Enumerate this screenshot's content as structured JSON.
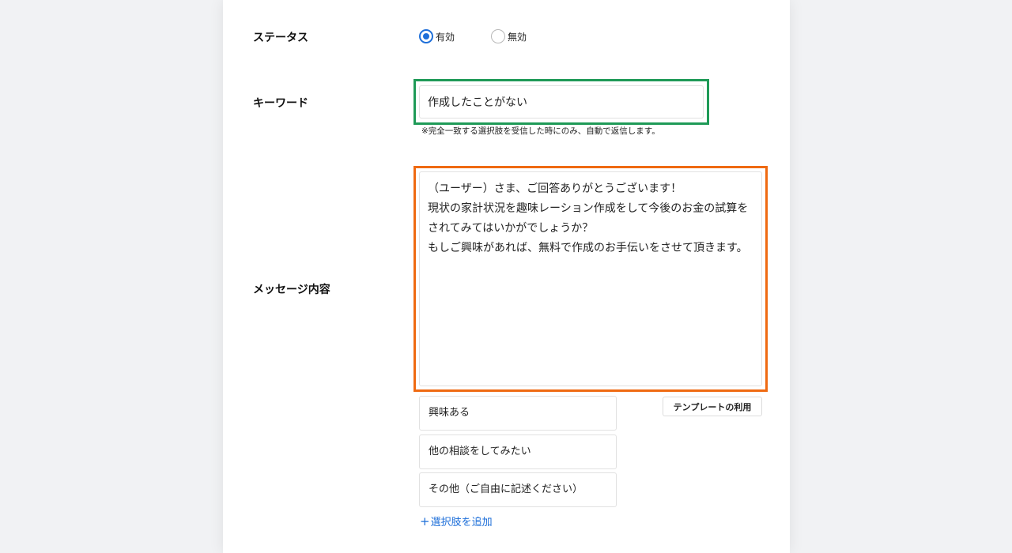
{
  "status": {
    "label": "ステータス",
    "options": [
      {
        "label": "有効",
        "selected": true
      },
      {
        "label": "無効",
        "selected": false
      }
    ]
  },
  "keyword": {
    "label": "キーワード",
    "value": "作成したことがない",
    "hint": "※完全一致する選択肢を受信した時にのみ、自動で返信します。",
    "highlight_color": "#1f9a57"
  },
  "message": {
    "label": "メッセージ内容",
    "text": "（ユーザー）さま、ご回答ありがとうございます！\n現状の家計状況を趣味レーション作成をして今後のお金の試算をされてみてはいかがでしょうか？\nもしご興味があれば、無料で作成のお手伝いをさせて頂きます。",
    "highlight_color": "#ef6a12",
    "template_button": "テンプレートの利用"
  },
  "choices": {
    "items": [
      "興味ある",
      "他の相談をしてみたい",
      "その他（ご自由に記述ください）"
    ],
    "add_icon": "+",
    "add_label": "選択肢を追加"
  },
  "colors": {
    "accent": "#1e6fd9",
    "background": "#f1f2f4"
  }
}
